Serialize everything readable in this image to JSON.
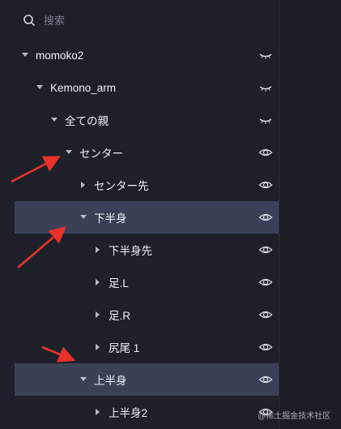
{
  "search": {
    "placeholder": "搜索",
    "icon": "search-icon"
  },
  "tree": [
    {
      "label": "momoko2",
      "caret": "down",
      "visibility": "hidden-eye-icon",
      "selected": false
    },
    {
      "label": "Kemono_arm",
      "caret": "down",
      "visibility": "hidden-eye-icon",
      "selected": false
    },
    {
      "label": "全ての親",
      "caret": "down",
      "visibility": "hidden-eye-icon",
      "selected": false
    },
    {
      "label": "センター",
      "caret": "down",
      "visibility": "eye-icon",
      "selected": false
    },
    {
      "label": "センター先",
      "caret": "right",
      "visibility": "eye-icon",
      "selected": false
    },
    {
      "label": "下半身",
      "caret": "down",
      "visibility": "eye-icon",
      "selected": true
    },
    {
      "label": "下半身先",
      "caret": "right",
      "visibility": "eye-icon",
      "selected": false
    },
    {
      "label": "足.L",
      "caret": "right",
      "visibility": "eye-icon",
      "selected": false
    },
    {
      "label": "足.R",
      "caret": "right",
      "visibility": "eye-icon",
      "selected": false
    },
    {
      "label": "尻尾 1",
      "caret": "right",
      "visibility": "eye-icon",
      "selected": false
    },
    {
      "label": "上半身",
      "caret": "down",
      "visibility": "eye-icon",
      "selected": true
    },
    {
      "label": "上半身2",
      "caret": "right",
      "visibility": "eye-icon",
      "selected": false
    }
  ],
  "watermark": "@稀土掘金技术社区",
  "colors": {
    "selected_row": "#3a4157",
    "annotation_arrow": "#e8322b"
  }
}
